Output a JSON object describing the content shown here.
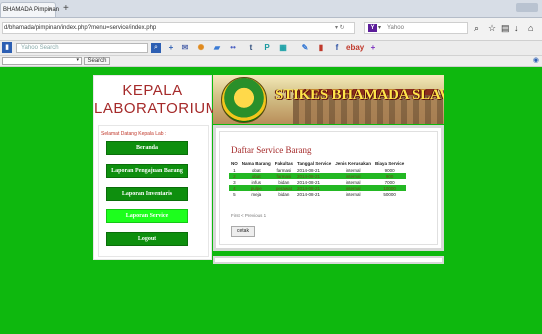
{
  "browser": {
    "tab_title": "BHAMADA Pimpinan",
    "tab_close": "×",
    "new_tab": "+",
    "url": "d/bhamada/pimpinan/index.php?menu=service/index.php",
    "search_placeholder": "Yahoo",
    "toolbar_search_placeholder": "Yahoo Search",
    "subbar_search_label": "Search"
  },
  "sidebar": {
    "title_line1": "KEPALA",
    "title_line2": "LABORATORIUM",
    "welcome": "Selamat Datang Kepala Lab :",
    "menu": [
      {
        "label": "Beranda"
      },
      {
        "label": "Laporan Pengajuan Barang"
      },
      {
        "label": "Laporan Inventaris"
      },
      {
        "label": "Laporan Service"
      },
      {
        "label": "Logout"
      }
    ]
  },
  "banner": {
    "title": "STIKES BHAMADA SLAWI"
  },
  "content": {
    "title": "Daftar Service Barang",
    "columns": [
      "NO",
      "Nama Barang",
      "Fakultas",
      "Tanggal Service",
      "Jenis Kerusakan",
      "Biaya Service"
    ],
    "rows": [
      [
        "1",
        "obat",
        "farmasi",
        "2014-08-21",
        "internal",
        "9000"
      ],
      [
        "2",
        "obat",
        "farmasi",
        "2014-08-21",
        "internal",
        "900"
      ],
      [
        "3",
        "infus",
        "bidan",
        "2014-08-21",
        "internal",
        "7000"
      ],
      [
        "4",
        "pulpe",
        "perawat",
        "2014-08-21",
        "internal",
        "10000"
      ],
      [
        "5",
        "meja",
        "bidan",
        "2014-08-21",
        "internal",
        "50000"
      ]
    ],
    "pager": "First < Previous 1",
    "print_label": "cetak"
  },
  "colors": {
    "page_bg": "#0eb80e",
    "menu_button": "#0e8f0e",
    "menu_active": "#1dff1d",
    "title_red": "#a52a2a"
  }
}
